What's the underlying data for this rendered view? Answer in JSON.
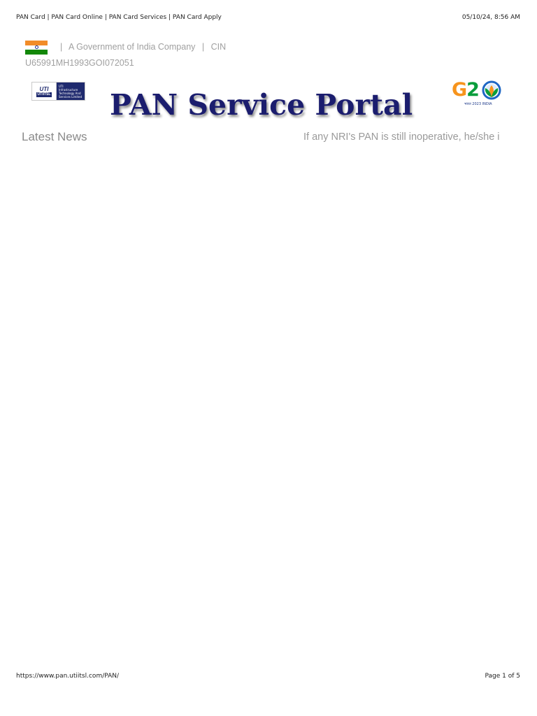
{
  "print_header": {
    "title": "PAN Card | PAN Card Online | PAN Card Services | PAN Card Apply",
    "datetime": "05/10/24, 8:56 AM"
  },
  "topbar": {
    "separator": "|",
    "company_text": "A Government of India Company",
    "cin_label": "CIN",
    "cin_value": "U65991MH1993GOI072051"
  },
  "logos": {
    "uti_badge_top": "UTI",
    "uti_badge_bottom": "UTIITSL",
    "uti_description": "UTI Infrastructure Technology And Services Limited",
    "g20_g": "G",
    "g20_two": "2",
    "g20_zero": "O",
    "g20_sub": "भारत 2023 INDIA"
  },
  "portal_title": "PAN Service Portal",
  "news": {
    "label": "Latest News",
    "ticker_text": "If any NRI's PAN is still inoperative, he/she i"
  },
  "print_footer": {
    "url": "https://www.pan.utiitsl.com/PAN/",
    "page": "Page 1 of 5"
  }
}
